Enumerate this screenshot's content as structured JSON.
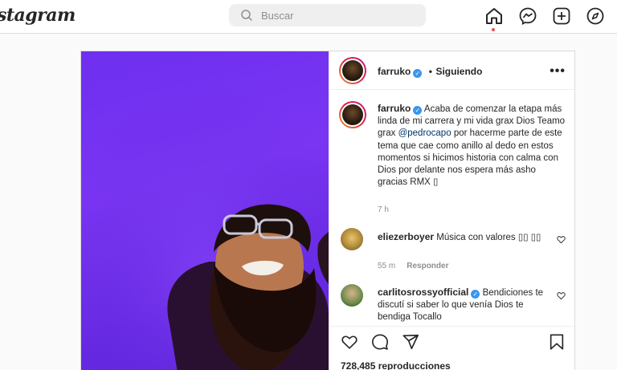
{
  "topbar": {
    "logo": "stagram",
    "search_placeholder": "Buscar",
    "icons": [
      "home-icon",
      "messenger-icon",
      "new-post-icon",
      "explore-icon"
    ]
  },
  "post": {
    "author": {
      "username": "farruko",
      "verified": true,
      "follow_separator": "•",
      "follow_label": "Siguiendo"
    },
    "more_label": "•••",
    "caption": {
      "username": "farruko",
      "text_before": "Acaba de comenzar la etapa más linda de mi carrera y mi vida grax Dios Teamo grax",
      "mention": "@pedrocapo",
      "text_after": "por hacerme parte de este tema que cae como anillo al dedo en estos momentos si hicimos historia con calma con Dios por delante nos espera más asho gracias RMX ▯",
      "time": "7 h"
    },
    "comments": [
      {
        "username": "eliezerboyer",
        "verified": false,
        "text": "Música con valores ▯▯ ▯▯",
        "time": "55 m",
        "reply_label": "Responder"
      },
      {
        "username": "carlitosrossyofficial",
        "verified": true,
        "text": "Bendiciones te discutí si saber lo que venía Dios te bendiga Tocallo"
      }
    ],
    "views": "728,485 reproducciones",
    "action_icons": [
      "heart-icon",
      "comment-icon",
      "share-icon",
      "bookmark-icon"
    ]
  },
  "colors": {
    "accent": "#3897f0",
    "mention": "#00376b",
    "media_bg": "#6e2ff0",
    "notification": "#ed4956"
  }
}
